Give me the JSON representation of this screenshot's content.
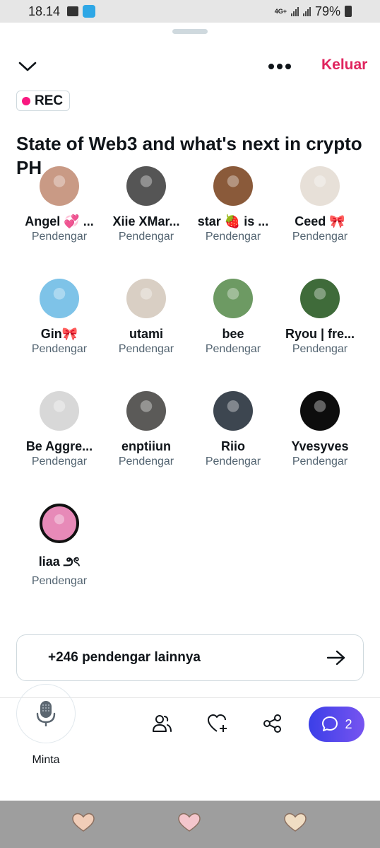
{
  "status_bar": {
    "time": "18.14",
    "network": "4G+",
    "battery": "79%",
    "icons": [
      "gallery-icon",
      "app-icon",
      "signal-icon",
      "battery-icon"
    ]
  },
  "header": {
    "leave_label": "Keluar",
    "leave_color": "#e0245e",
    "icons": [
      "chevron-down-icon",
      "more-icon"
    ]
  },
  "rec_badge": {
    "label": "REC",
    "dot_color": "#f91880"
  },
  "space_title": "State of Web3 and what's next in crypto PH",
  "listeners": [
    {
      "name": "Angel 💞 ...",
      "role": "Pendengar",
      "avatar_bg": "#c99a85"
    },
    {
      "name": "Xiie XMar...",
      "role": "Pendengar",
      "avatar_bg": "#555555"
    },
    {
      "name": "star 🍓 is ...",
      "role": "Pendengar",
      "avatar_bg": "#8a5a3a"
    },
    {
      "name": "Ceed 🎀",
      "role": "Pendengar",
      "avatar_bg": "#e7e0d8"
    },
    {
      "name": "Gin🎀",
      "role": "Pendengar",
      "avatar_bg": "#7ec3e8"
    },
    {
      "name": "utami",
      "role": "Pendengar",
      "avatar_bg": "#d9cfc4"
    },
    {
      "name": "bee",
      "role": "Pendengar",
      "avatar_bg": "#6d9a63"
    },
    {
      "name": "Ryou | fre...",
      "role": "Pendengar",
      "avatar_bg": "#3f6b3a"
    },
    {
      "name": "Be Aggre...",
      "role": "Pendengar",
      "avatar_bg": "#d8d8d8"
    },
    {
      "name": "enptiiun",
      "role": "Pendengar",
      "avatar_bg": "#5b5a58"
    },
    {
      "name": "Riio",
      "role": "Pendengar",
      "avatar_bg": "#3d4650"
    },
    {
      "name": "Yvesyves",
      "role": "Pendengar",
      "avatar_bg": "#0d0d0d"
    },
    {
      "name": "liaa ౨ৎ",
      "role": "Pendengar",
      "avatar_bg": "#e78ab8"
    }
  ],
  "more_listeners": {
    "label": "+246 pendengar lainnya"
  },
  "bottom_bar": {
    "mic_label": "Minta",
    "chat_count": "2",
    "chat_gradient": [
      "#3b3fe8",
      "#7754f0"
    ],
    "icons": [
      "microphone-icon",
      "people-icon",
      "heart-plus-icon",
      "share-icon",
      "chat-icon"
    ]
  },
  "nav_bar": {
    "icons": [
      "heart-icon",
      "heart-icon",
      "heart-icon"
    ],
    "colors": [
      "#f1cdb8",
      "#f4c6cc",
      "#f0ddc3"
    ]
  }
}
